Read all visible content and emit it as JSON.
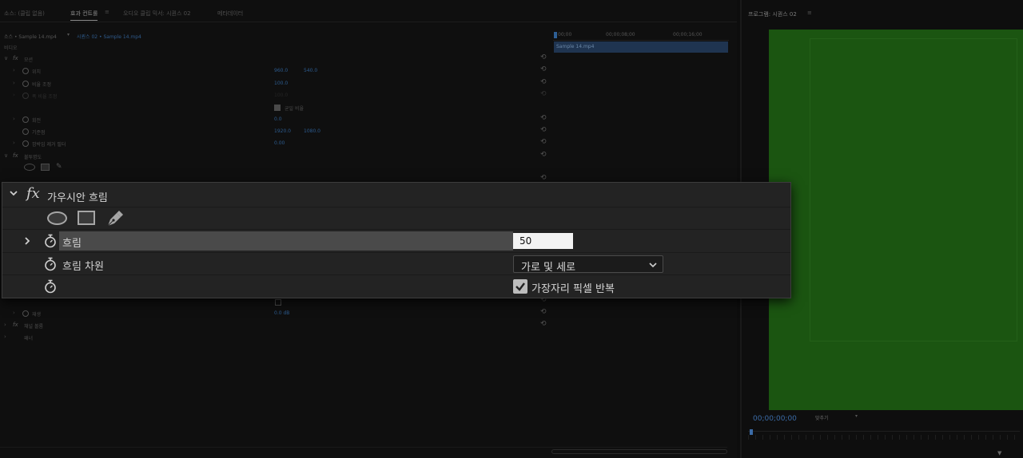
{
  "tabs": [
    {
      "label": "소스: (클립 없음)"
    },
    {
      "label": "효과 컨트롤"
    },
    {
      "label": "오디오 클립 믹서: 시퀀스 02"
    },
    {
      "label": "메타데이터"
    }
  ],
  "tab_menu_glyph": "≡",
  "breadcrumb": {
    "source": "소스 • Sample 14.mp4",
    "arrow": "▾",
    "sequence": "시퀀스 02 • Sample 14.mp4"
  },
  "effects": {
    "video_header": "비디오",
    "motion": {
      "name": "모션"
    },
    "position": {
      "label": "위치",
      "x": "960.0",
      "y": "540.0"
    },
    "scale": {
      "label": "비율 조정",
      "value": "100.0"
    },
    "scale_width": {
      "label": "폭 비율 조정",
      "value": "100.0"
    },
    "uniform_scale": {
      "label": "균일 비율"
    },
    "rotation": {
      "label": "회전",
      "value": "0.0"
    },
    "anchor": {
      "label": "기준점",
      "x": "1920.0",
      "y": "1080.0"
    },
    "flicker": {
      "label": "깜박임 제거 필터",
      "value": "0.00"
    },
    "opacity": {
      "name": "불투명도"
    },
    "bottom_row": {
      "label": "재생",
      "value": "0.0 dB"
    },
    "channel_volume": {
      "name": "채널 볼륨"
    },
    "panner": {
      "name": "패너"
    }
  },
  "timeline": {
    "t0": "00;00",
    "t1": "00;00;08;00",
    "t2": "00;00;16;00",
    "clip_name": "Sample 14.mp4"
  },
  "program": {
    "title": "프로그램: 시퀀스 02",
    "menu": "≡",
    "timecode": "00;00;00;00",
    "fit_label": "맞추기",
    "fit_arrow": "▾"
  },
  "blur": {
    "fx_symbol": "fx",
    "title": "가우시안 흐림",
    "blurriness": {
      "label": "흐림",
      "value": "50"
    },
    "dimension": {
      "label": "흐림 차원",
      "value": "가로 및 세로"
    },
    "repeat_edge": {
      "label": "가장자리 픽셀 반복",
      "checked": true
    }
  },
  "colors": {
    "accent": "#2c5b8e",
    "program_video": "#1b5511",
    "panel": "#232323"
  }
}
